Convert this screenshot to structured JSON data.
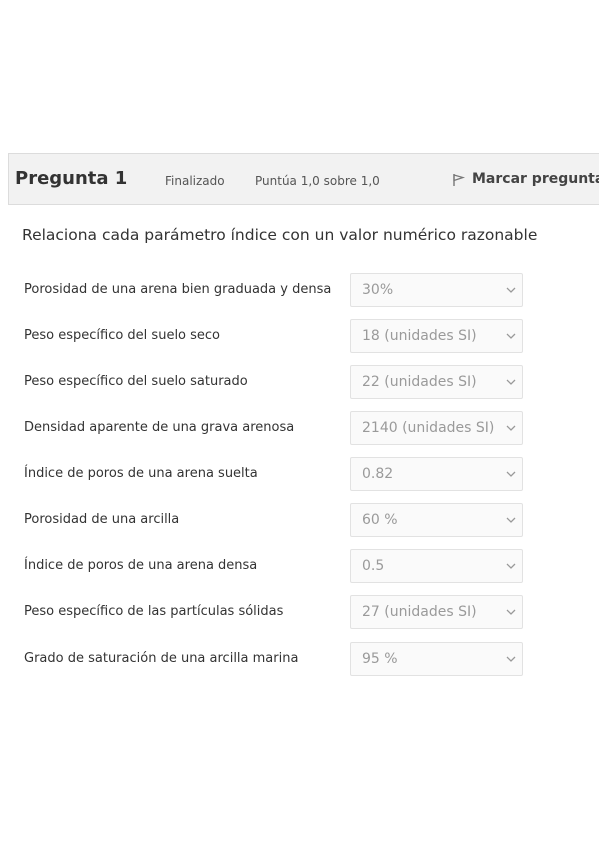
{
  "question": {
    "title": "Pregunta 1",
    "state": "Finalizado",
    "grade": "Puntúa 1,0 sobre 1,0",
    "flag_label": "Marcar pregunta",
    "text": "Relaciona cada parámetro índice con un valor numérico razonable"
  },
  "rows": [
    {
      "label": "Porosidad de una arena bien graduada y densa",
      "value": "30%"
    },
    {
      "label": "Peso específico del suelo seco",
      "value": "18 (unidades SI)"
    },
    {
      "label": "Peso específico del suelo saturado",
      "value": "22 (unidades SI)"
    },
    {
      "label": "Densidad aparente de una grava arenosa",
      "value": "2140 (unidades SI)"
    },
    {
      "label": "Índice de poros de una arena suelta",
      "value": "0.82"
    },
    {
      "label": "Porosidad de una arcilla",
      "value": "60 %"
    },
    {
      "label": "Índice de poros de una arena densa",
      "value": "0.5"
    },
    {
      "label": "Peso específico de las partículas sólidas",
      "value": "27 (unidades SI)"
    },
    {
      "label": "Grado de saturación de una arcilla marina",
      "value": "95 %"
    }
  ]
}
